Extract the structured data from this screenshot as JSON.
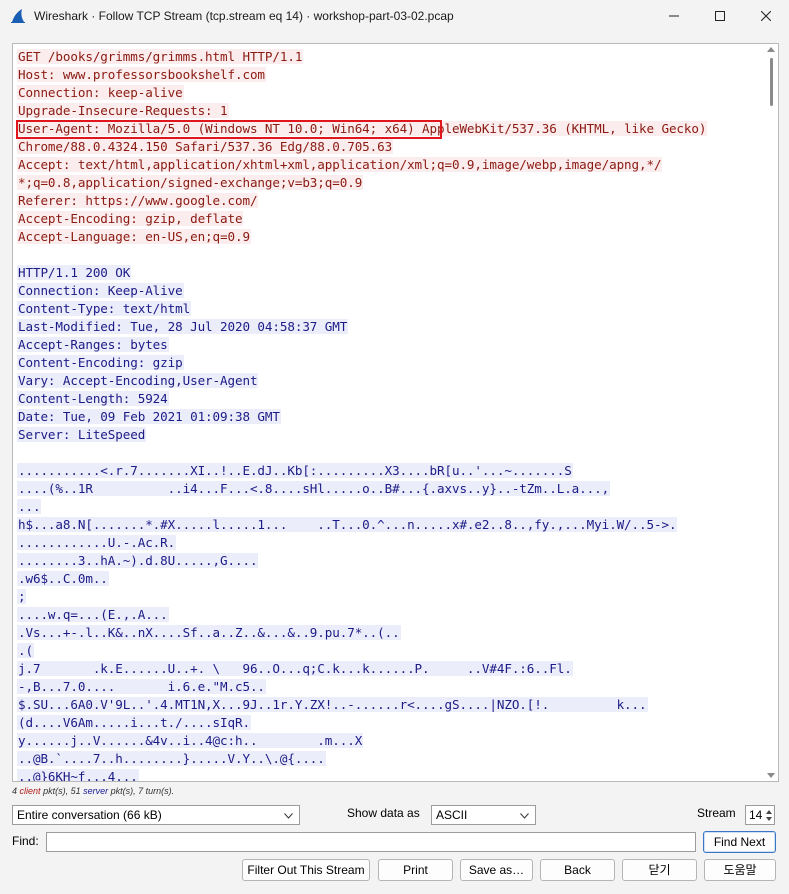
{
  "window": {
    "title": "Wireshark · Follow TCP Stream (tcp.stream eq 14) · workshop-part-03-02.pcap",
    "icon": "wireshark-fin-icon"
  },
  "stream": {
    "request_lines": [
      "GET /books/grimms/grimms.html HTTP/1.1",
      "Host: www.professorsbookshelf.com",
      "Connection: keep-alive",
      "Upgrade-Insecure-Requests: 1",
      "User-Agent: Mozilla/5.0 (Windows NT 10.0; Win64; x64) AppleWebKit/537.36 (KHTML, like Gecko)",
      "Chrome/88.0.4324.150 Safari/537.36 Edg/88.0.705.63",
      "Accept: text/html,application/xhtml+xml,application/xml;q=0.9,image/webp,image/apng,*/",
      "*;q=0.8,application/signed-exchange;v=b3;q=0.9",
      "Referer: https://www.google.com/",
      "Accept-Encoding: gzip, deflate",
      "Accept-Language: en-US,en;q=0.9"
    ],
    "response_header_lines": [
      "HTTP/1.1 200 OK",
      "Connection: Keep-Alive",
      "Content-Type: text/html",
      "Last-Modified: Tue, 28 Jul 2020 04:58:37 GMT",
      "Accept-Ranges: bytes",
      "Content-Encoding: gzip",
      "Vary: Accept-Encoding,User-Agent",
      "Content-Length: 5924",
      "Date: Tue, 09 Feb 2021 01:09:38 GMT",
      "Server: LiteSpeed"
    ],
    "response_body_lines": [
      "...........<.r.7.......XI..!..E.dJ..Kb[:.........X3....bR[u..'...~.......S",
      "....(%..1R          ..i4...F...<.8....sHl.....o..B#...{.axvs..y}..-tZm..L.a...,",
      "...",
      "h$...a8.N[.......*.#X.....l.....1...    ..T...0.^...n.....x#.e2..8..,fy.,...Myi.W/..5->.",
      "............U.-.Ac.R.",
      "........3..hA.~).d.8U.....,G....",
      ".w6$..C.0m..",
      ";",
      "....w.q=...(E.,.A...",
      ".Vs...+-.l..K&..nX....Sf..a..Z..&...&..9.pu.7*..(..",
      ".(",
      "j.7       .k.E......U..+. \\   96..O...q;C.k...k......P.     ..V#4F.:6..Fl.",
      "-,B...7.0....       i.6.e.\"M.c5..",
      "$.SU...6A0.V'9L..'.4.MT1N,X...9J..1r.Y.ZX!..-......r<....gS....|NZO.[!.         k...",
      "(d....V6Am.....i...t./....sIqR.",
      "y......j..V......&4v..i..4@c:h..        .m...X",
      "..@B.`....7..h........}.....V.Y..\\.@{....",
      "..@}6KH~f...4..."
    ]
  },
  "stats": {
    "client_count": "4",
    "client_word": "client",
    "client_suffix": "pkt(s),",
    "server_count": "51",
    "server_word": "server",
    "server_suffix": "pkt(s), 7 turn(s)."
  },
  "controls": {
    "conversation_select": "Entire conversation (66 kB)",
    "show_data_label": "Show data as",
    "show_data_select": "ASCII",
    "stream_label": "Stream",
    "stream_value": "14",
    "find_label": "Find:",
    "find_value": "",
    "find_next": "Find Next",
    "filter_out": "Filter Out This Stream",
    "print": "Print",
    "save_as": "Save as…",
    "back": "Back",
    "close": "닫기",
    "help": "도움말"
  },
  "colors": {
    "client_text": "#8b1a12",
    "client_bg": "#fbeded",
    "server_text": "#1b1b86",
    "server_bg": "#ecedfb",
    "highlight_border": "#e0161c"
  }
}
